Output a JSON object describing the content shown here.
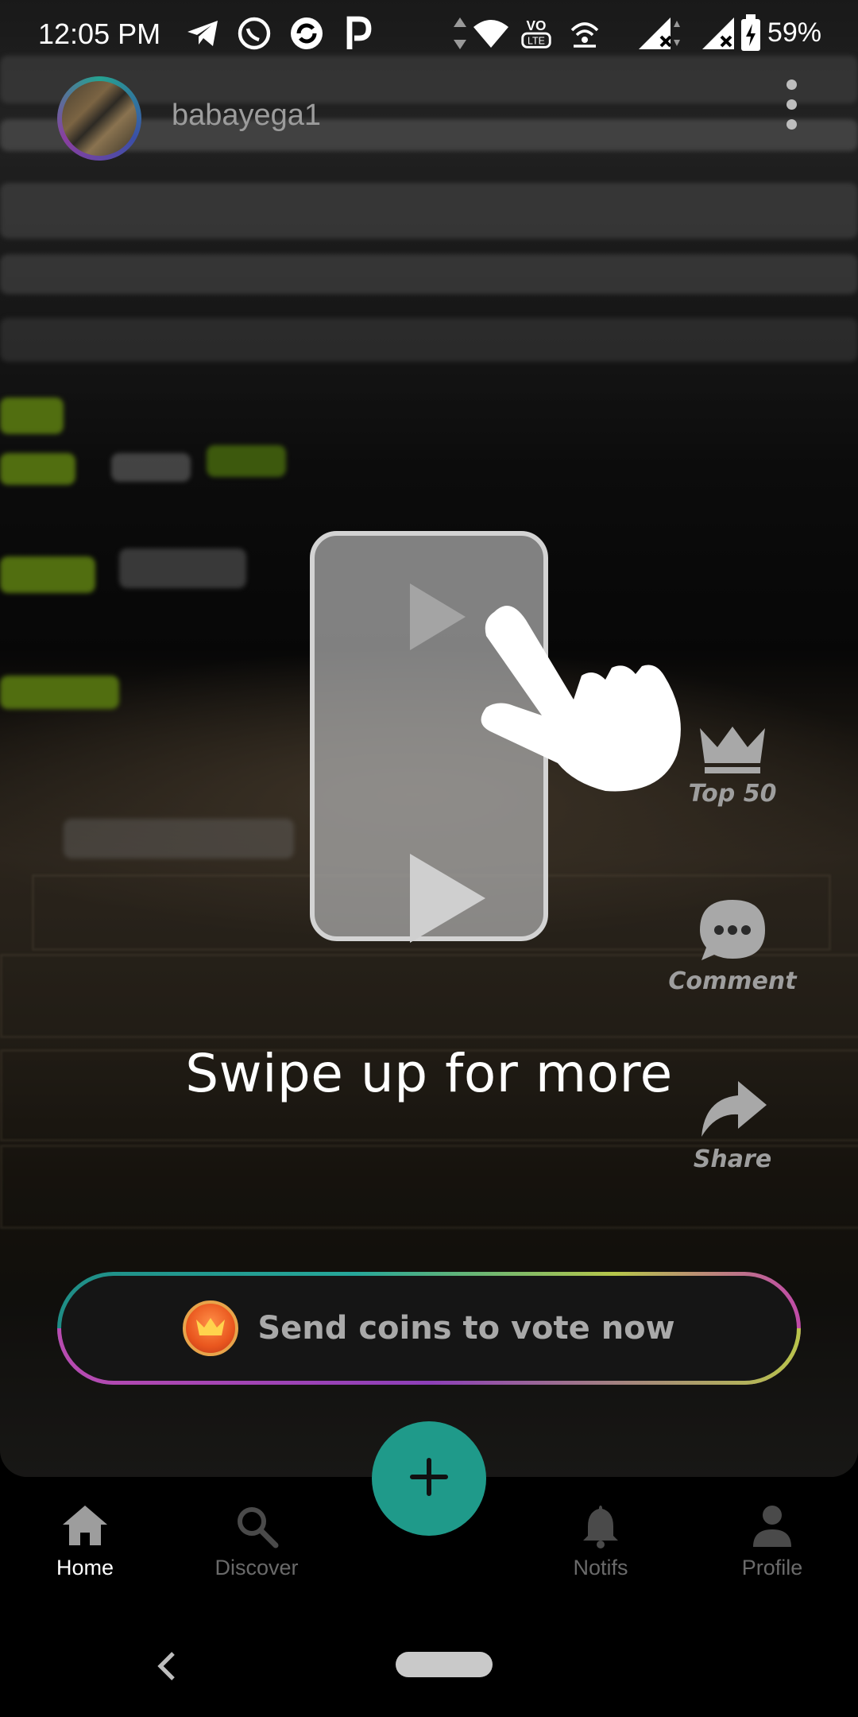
{
  "status_bar": {
    "time": "12:05 PM",
    "battery": "59%",
    "icons": [
      "telegram-icon",
      "whatsapp-icon",
      "sync-icon",
      "p-icon",
      "data-arrows-icon",
      "wifi-icon",
      "volte-icon",
      "hotspot-icon",
      "signal-icon",
      "signal-icon-2",
      "battery-icon"
    ]
  },
  "header": {
    "username": "babayega1"
  },
  "overlay": {
    "swipe_text": "Swipe up for more"
  },
  "side_actions": [
    {
      "label": "Top 50",
      "icon": "crown-icon"
    },
    {
      "label": "Comment",
      "icon": "chat-bubble-icon"
    },
    {
      "label": "Share",
      "icon": "share-arrow-icon"
    }
  ],
  "vote_button": {
    "label": "Send coins to vote now",
    "icon": "crown-coin-icon"
  },
  "bottom_nav": {
    "items": [
      {
        "label": "Home",
        "icon": "home-icon",
        "active": true
      },
      {
        "label": "Discover",
        "icon": "search-icon",
        "active": false
      },
      {
        "label": "Notifs",
        "icon": "bell-icon",
        "active": false
      },
      {
        "label": "Profile",
        "icon": "person-icon",
        "active": false
      }
    ]
  },
  "colors": {
    "accent": "#1f9a8a",
    "inactive_label": "#6a6a6a",
    "vote_border_start": "#26a79a",
    "vote_border_end": "#c04aa8"
  }
}
